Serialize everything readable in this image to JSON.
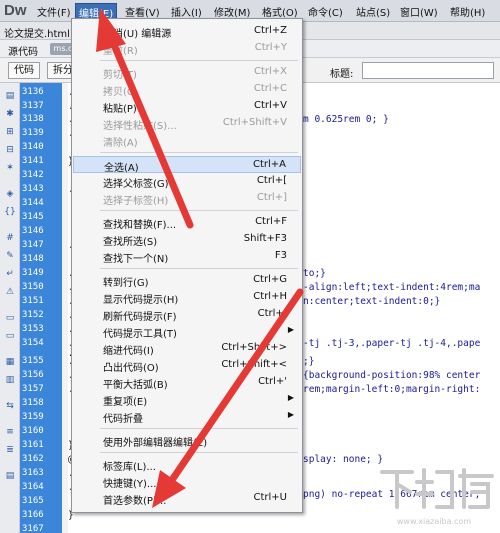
{
  "app": {
    "logo": "Dw"
  },
  "menubar": {
    "items": [
      "文件(F)",
      "编辑(E)",
      "查看(V)",
      "插入(I)",
      "修改(M)",
      "格式(O)",
      "命令(C)",
      "站点(S)",
      "窗口(W)",
      "帮助(H)"
    ]
  },
  "document": {
    "tab": "论文提交.html"
  },
  "source_bar": {
    "label": "源代码",
    "chip": "ms.c"
  },
  "toolbar": {
    "code_btn": "代码",
    "split_btn": "拆分",
    "title_label": "标题:"
  },
  "gutter": {
    "lines": [
      "3136",
      "3137",
      "3138",
      "3139",
      "3140",
      "3141",
      "3142",
      "3143",
      "3144",
      "3145",
      "3146",
      "3147",
      "3148",
      "3149",
      "3150",
      "3151",
      "3152",
      "3153",
      "3154",
      "3155",
      "3156",
      "3157",
      "3158",
      "3159",
      "3160",
      "3161",
      "3162",
      "3163",
      "3164",
      "3165",
      "3166",
      "3167"
    ]
  },
  "code": {
    "fragments": [
      "m 0.625rem 0; }",
      "to;}",
      "-align:left;text-indent:4rem;ma",
      "n:center;text-indent:0;}",
      "-tj .tj-3,.paper-tj .tj-4,.pape",
      ";}",
      "{background-position:98% center",
      "rem;margin-left:0;margin-right:",
      "splay: none; }",
      "png) no-repeat 1.667rem center;"
    ],
    "left": {
      "l3136": ".a",
      "l3137": ".u",
      "l3138": ".u",
      "l3139": ".u",
      "l3141": "}",
      "l3143": ".u",
      "l3147": ".l",
      "l3149": ".u",
      "l3150": ".u",
      "l3151": ".u",
      "l3152": ".p",
      "l3153": ".p",
      "l3154": ".p",
      "l3154b": "1.",
      "l3155": ".p",
      "l3156": ".p",
      "l3157": ".p",
      "l3161": "}",
      "l3162": "@m",
      "l3163": ".t",
      "l3164": ".t",
      "l3166": "}"
    }
  },
  "edit_menu": {
    "items": [
      {
        "label": "撤消(U) 编辑源",
        "shortcut": "Ctrl+Z",
        "enabled": true
      },
      {
        "label": "重做(R)",
        "shortcut": "Ctrl+Y",
        "enabled": false
      },
      {
        "label": "剪切(T)",
        "shortcut": "Ctrl+X",
        "enabled": false
      },
      {
        "label": "拷贝(C)",
        "shortcut": "Ctrl+C",
        "enabled": false
      },
      {
        "label": "粘贴(P)",
        "shortcut": "Ctrl+V",
        "enabled": true
      },
      {
        "label": "选择性粘贴(S)...",
        "shortcut": "Ctrl+Shift+V",
        "enabled": false
      },
      {
        "label": "清除(A)",
        "shortcut": "",
        "enabled": false
      },
      {
        "label": "全选(A)",
        "shortcut": "Ctrl+A",
        "enabled": true,
        "highlighted": true
      },
      {
        "label": "选择父标签(G)",
        "shortcut": "Ctrl+[",
        "enabled": true
      },
      {
        "label": "选择子标签(H)",
        "shortcut": "Ctrl+]",
        "enabled": false
      },
      {
        "label": "查找和替换(F)...",
        "shortcut": "Ctrl+F",
        "enabled": true
      },
      {
        "label": "查找所选(S)",
        "shortcut": "Shift+F3",
        "enabled": true
      },
      {
        "label": "查找下一个(N)",
        "shortcut": "F3",
        "enabled": true
      },
      {
        "label": "转到行(G)",
        "shortcut": "Ctrl+G",
        "enabled": true
      },
      {
        "label": "显示代码提示(H)",
        "shortcut": "Ctrl+H",
        "enabled": true
      },
      {
        "label": "刷新代码提示(F)",
        "shortcut": "Ctrl+.",
        "enabled": true
      },
      {
        "label": "代码提示工具(T)",
        "shortcut": "",
        "enabled": true,
        "submenu": true
      },
      {
        "label": "缩进代码(I)",
        "shortcut": "Ctrl+Shift+>",
        "enabled": true
      },
      {
        "label": "凸出代码(O)",
        "shortcut": "Ctrl+Shift+<",
        "enabled": true
      },
      {
        "label": "平衡大括弧(B)",
        "shortcut": "Ctrl+'",
        "enabled": true
      },
      {
        "label": "重复项(E)",
        "shortcut": "",
        "enabled": true,
        "submenu": true
      },
      {
        "label": "代码折叠",
        "shortcut": "",
        "enabled": true,
        "submenu": true
      },
      {
        "label": "使用外部编辑器编辑(E)",
        "shortcut": "",
        "enabled": true
      },
      {
        "label": "标签库(L)...",
        "shortcut": "",
        "enabled": true
      },
      {
        "label": "快捷键(Y)...",
        "shortcut": "",
        "enabled": true
      },
      {
        "label": "首选参数(P)...",
        "shortcut": "Ctrl+U",
        "enabled": true
      }
    ]
  },
  "watermark": {
    "text": "下载吧",
    "url": "www.xiazaiba.com"
  },
  "colors": {
    "gutter": "#3c86d9",
    "menu_active": "#3b6fb6",
    "arrow": "#e53935"
  },
  "icons": [
    "dw-sidebar-icons",
    "submenu-arrow-icon",
    "red-arrow-annotation"
  ]
}
